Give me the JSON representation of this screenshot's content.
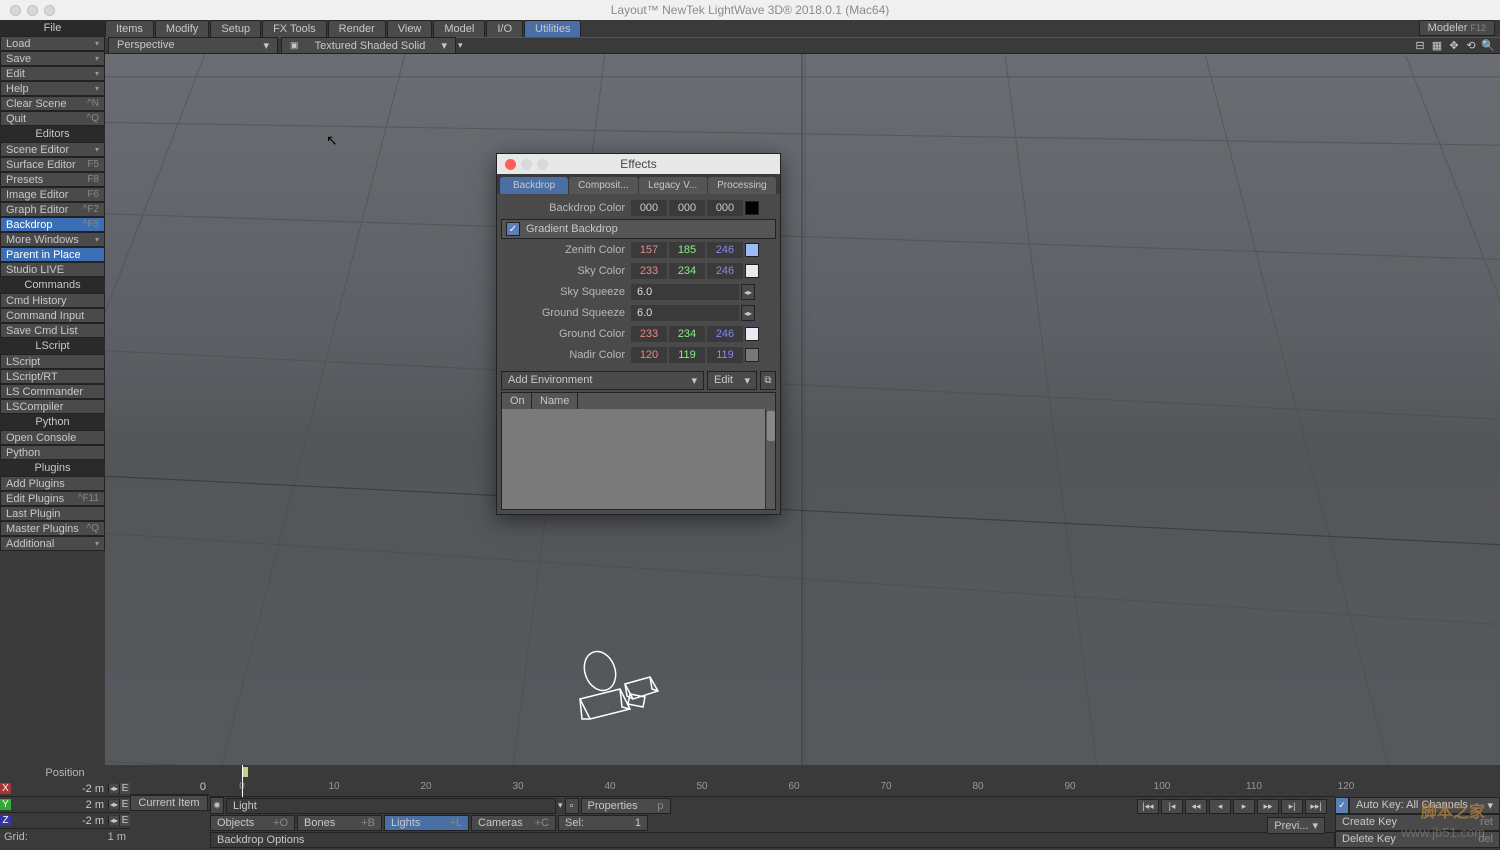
{
  "window": {
    "title": "Layout™ NewTek LightWave 3D® 2018.0.1 (Mac64)"
  },
  "menubar": {
    "items": [
      "Items",
      "Modify",
      "Setup",
      "FX Tools",
      "Render",
      "View",
      "Model",
      "I/O",
      "Utilities"
    ],
    "active": 8
  },
  "right_tab": {
    "label": "Modeler",
    "hotkey": "F12"
  },
  "vpbar": {
    "view": "Perspective",
    "shading": "Textured Shaded Solid"
  },
  "sidebar": {
    "sections": [
      {
        "title": "File",
        "items": [
          {
            "label": "Load",
            "dd": true
          },
          {
            "label": "Save",
            "dd": true
          },
          {
            "label": "Edit",
            "dd": true
          },
          {
            "label": "Help",
            "dd": true
          },
          {
            "label": "Clear Scene",
            "hk": "^N"
          },
          {
            "label": "Quit",
            "hk": "^Q"
          }
        ]
      },
      {
        "title": "Editors",
        "items": [
          {
            "label": "Scene Editor",
            "dd": true
          },
          {
            "label": "Surface Editor",
            "hk": "F5"
          },
          {
            "label": "Presets",
            "hk": "F8"
          },
          {
            "label": "Image Editor",
            "hk": "F6"
          },
          {
            "label": "Graph Editor",
            "hk": "^F2"
          },
          {
            "label": "Backdrop",
            "hk": "^F5",
            "sel": true
          },
          {
            "label": "More Windows",
            "dd": true
          },
          {
            "label": "Parent in Place",
            "sel": true
          },
          {
            "label": "Studio LIVE"
          }
        ]
      },
      {
        "title": "Commands",
        "items": [
          {
            "label": "Cmd History"
          },
          {
            "label": "Command Input"
          },
          {
            "label": "Save Cmd List"
          }
        ]
      },
      {
        "title": "LScript",
        "items": [
          {
            "label": "LScript"
          },
          {
            "label": "LScript/RT"
          },
          {
            "label": "LS Commander"
          },
          {
            "label": "LSCompiler"
          }
        ]
      },
      {
        "title": "Python",
        "items": [
          {
            "label": "Open Console"
          },
          {
            "label": "Python"
          }
        ]
      },
      {
        "title": "Plugins",
        "items": [
          {
            "label": "Add Plugins"
          },
          {
            "label": "Edit Plugins",
            "hk": "^F11"
          },
          {
            "label": "Last Plugin"
          },
          {
            "label": "Master Plugins",
            "hk": "^Q"
          },
          {
            "label": "Additional",
            "dd": true
          }
        ]
      }
    ]
  },
  "effects": {
    "title": "Effects",
    "tabs": [
      "Backdrop",
      "Composit...",
      "Legacy V...",
      "Processing"
    ],
    "active": 0,
    "backdrop_color_label": "Backdrop Color",
    "backdrop_color": [
      "000",
      "000",
      "000"
    ],
    "backdrop_swatch": "#000000",
    "gradient_label": "Gradient Backdrop",
    "gradient_checked": true,
    "rows": [
      {
        "label": "Zenith Color",
        "vals": [
          "157",
          "185",
          "246"
        ],
        "swatch": "#9db9f6"
      },
      {
        "label": "Sky Color",
        "vals": [
          "233",
          "234",
          "246"
        ],
        "swatch": "#e9eaf6"
      }
    ],
    "sky_squeeze_label": "Sky Squeeze",
    "sky_squeeze": "6.0",
    "ground_squeeze_label": "Ground Squeeze",
    "ground_squeeze": "6.0",
    "rows2": [
      {
        "label": "Ground Color",
        "vals": [
          "233",
          "234",
          "246"
        ],
        "swatch": "#e9eaf6"
      },
      {
        "label": "Nadir Color",
        "vals": [
          "120",
          "119",
          "119"
        ],
        "swatch": "#787777"
      }
    ],
    "add_env": "Add Environment",
    "edit": "Edit",
    "list_cols": [
      "On",
      "Name"
    ]
  },
  "coords": {
    "title": "Position",
    "rows": [
      {
        "axis": "X",
        "val": "-2 m"
      },
      {
        "axis": "Y",
        "val": "2 m"
      },
      {
        "axis": "Z",
        "val": "-2 m"
      }
    ],
    "grid_label": "Grid:",
    "grid_val": "1 m"
  },
  "timeline": {
    "frame0": "0",
    "ticks": [
      "0",
      "10",
      "20",
      "30",
      "40",
      "50",
      "60",
      "70",
      "80",
      "90",
      "100",
      "110",
      "120"
    ],
    "current_item_label": "Current Item",
    "current_item": "Light",
    "modes": [
      {
        "l": "Objects",
        "k": "+O"
      },
      {
        "l": "Bones",
        "k": "+B"
      },
      {
        "l": "Lights",
        "k": "+L",
        "a": true
      },
      {
        "l": "Cameras",
        "k": "+C"
      }
    ],
    "sel_label": "Sel:",
    "sel_val": "1",
    "props_label": "Properties",
    "props_k": "p",
    "status": "Backdrop Options",
    "prev": "Previ..."
  },
  "keys": {
    "autokey_label": "Auto Key: All Channels",
    "create": "Create Key",
    "create_k": "ret",
    "delete": "Delete Key",
    "delete_k": "del"
  },
  "watermark": "www.jb51.com",
  "watermark2": "脚本之家"
}
